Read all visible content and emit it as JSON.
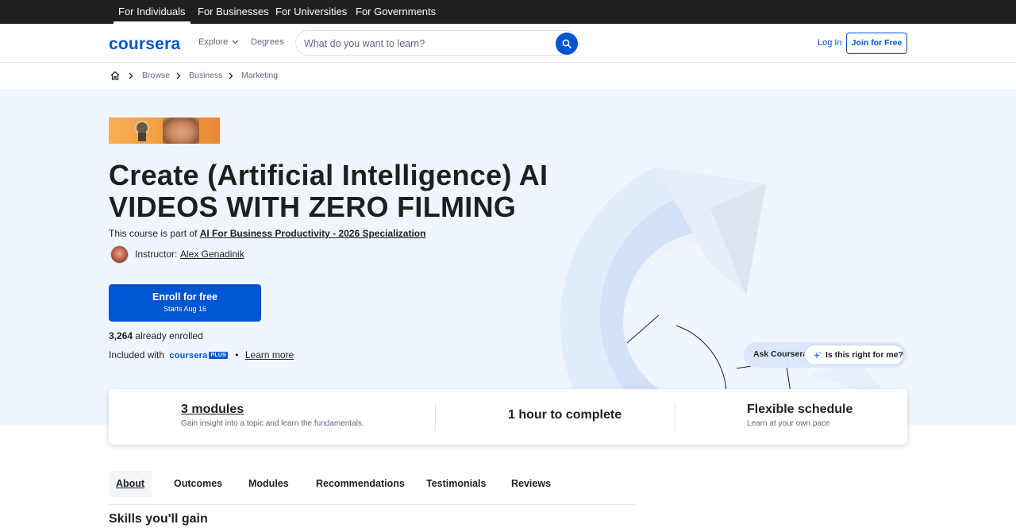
{
  "audience_nav": {
    "individuals": "For Individuals",
    "businesses": "For Businesses",
    "universities": "For Universities",
    "governments": "For Governments"
  },
  "header": {
    "logo": "coursera",
    "explore": "Explore",
    "degrees": "Degrees",
    "search_placeholder": "What do you want to learn?",
    "login": "Log In",
    "join": "Join for Free"
  },
  "breadcrumb": {
    "items": [
      "Browse",
      "Business",
      "Marketing"
    ]
  },
  "course": {
    "title": "Create (Artificial Intelligence) AI VIDEOS WITH ZERO FILMING",
    "part_of_prefix": "This course is part of",
    "specialization": "AI For Business Productivity - 2026 Specialization",
    "instructor_label": "Instructor:",
    "instructor_name": "Alex Genadinik",
    "enroll_label": "Enroll for free",
    "enroll_sub": "Starts Aug 16",
    "enrolled_count": "3,264",
    "enrolled_suffix": "already enrolled",
    "included_with": "Included with",
    "plus_logo": "coursera",
    "plus_tag": "PLUS",
    "learn_more": "Learn more"
  },
  "ask": {
    "label": "Ask Coursera",
    "button": "Is this right for me?"
  },
  "info_card": {
    "modules_title": "3 modules",
    "modules_sub": "Gain insight into a topic and learn the fundamentals.",
    "duration": "1 hour to complete",
    "schedule_title": "Flexible schedule",
    "schedule_sub": "Learn at your own pace"
  },
  "tabs": [
    "About",
    "Outcomes",
    "Modules",
    "Recommendations",
    "Testimonials",
    "Reviews"
  ],
  "sections": {
    "skills_title": "Skills you'll gain"
  },
  "colors": {
    "brand_blue": "#0056d2",
    "hero_bg": "#f0f6ff",
    "top_bar": "#1f1f1f"
  }
}
